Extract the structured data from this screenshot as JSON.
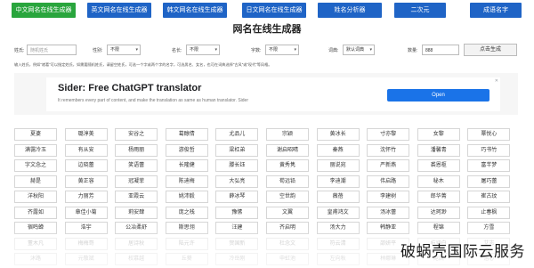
{
  "nav": {
    "items": [
      {
        "label": "中文网名在线生成器",
        "active": true
      },
      {
        "label": "英文网名在线生成器",
        "active": false
      },
      {
        "label": "韩文网名在线生成器",
        "active": false
      },
      {
        "label": "日文网名在线生成器",
        "active": false
      },
      {
        "label": "姓名分析器",
        "active": false
      },
      {
        "label": "二次元",
        "active": false
      },
      {
        "label": "成语名字",
        "active": false
      }
    ],
    "colors": {
      "primary": "#1f64c6",
      "active": "#29a53d"
    }
  },
  "page": {
    "title": "网名在线生成器"
  },
  "form": {
    "fields": [
      {
        "label": "姓氏:",
        "kind": "input",
        "value": "",
        "placeholder": "随机姓氏"
      },
      {
        "label": "性别:",
        "kind": "select",
        "value": "不限"
      },
      {
        "label": "名长:",
        "kind": "select",
        "value": "不限"
      },
      {
        "label": "字数:",
        "kind": "select",
        "value": "不限"
      },
      {
        "label": "词典:",
        "kind": "select",
        "value": "默认词典"
      },
      {
        "label": "数量:",
        "kind": "input",
        "value": "888",
        "placeholder": ""
      }
    ],
    "generate_label": "点击生成",
    "note": "输入姓氏，例如\"诸葛\"可以指定姓氏，如需要随机姓氏，请留空姓氏，可选一个字或两个字的名字，可选男名、女名，也可在词典选择\"古风\"或\"现代\"等风格。"
  },
  "ad": {
    "title": "Sider: Free ChatGPT translator",
    "subtitle": "It remembers every part of content, and make the translation as same as human translator. Sider",
    "open_label": "Open",
    "close_label": "✕"
  },
  "names": [
    [
      "夏婆",
      "璐淳美",
      "安谷之",
      "葛醇倩",
      "尤品儿",
      "宗颖",
      "黄冰长",
      "寸亦黎",
      "女黎",
      "覃悦心"
    ],
    [
      "满霭冷玉",
      "有从安",
      "杨雨丽",
      "游俊哲",
      "梁杠弟",
      "谢启昭晴",
      "秦燕",
      "沈怀竹",
      "潘馨青",
      "巧书竹"
    ],
    [
      "字文念之",
      "边晓蕾",
      "笑语蕾",
      "长隆健",
      "滕长钰",
      "黄秀隽",
      "丽说宛",
      "严新燕",
      "裘恩枢",
      "富芊梦"
    ],
    [
      "赫是",
      "黄正容",
      "冠凝菲",
      "陈迪梅",
      "大弘亮",
      "荀远铅",
      "李迪潮",
      "伟启路",
      "秘木",
      "屠巧蕾"
    ],
    [
      "洋秋阳",
      "力丽芳",
      "亚霞云",
      "姚沛毅",
      "薛冰琴",
      "空世韵",
      "薇蓓",
      "李建树",
      "郎华菁",
      "崔古玟"
    ],
    [
      "齐露如",
      "章佳小菊",
      "莉安肆",
      "庞之栈",
      "豫愫",
      "文翼",
      "皇甫鸿文",
      "汤冰蕾",
      "达珂渺",
      "止春枫"
    ],
    [
      "宿鸣蝉",
      "浩宇",
      "公冶柔舒",
      "斯思翎",
      "汪建",
      "齐启明",
      "汤大力",
      "韩静亚",
      "程锦",
      "方雪"
    ],
    [
      "董木凡",
      "梅梅哥",
      "居诗秋",
      "陆元许",
      "贺国新",
      "杜念文",
      "符云清",
      "邵妍平",
      "杭涵白",
      "艾志"
    ],
    [
      "沐路",
      "元敬斌",
      "权慕越",
      "丘葵",
      "冷岳刚",
      "申虹池",
      "左向秋",
      "林娜琳",
      "鲍凯",
      "洛心"
    ]
  ],
  "watermark": "破蜗壳国际云服务"
}
